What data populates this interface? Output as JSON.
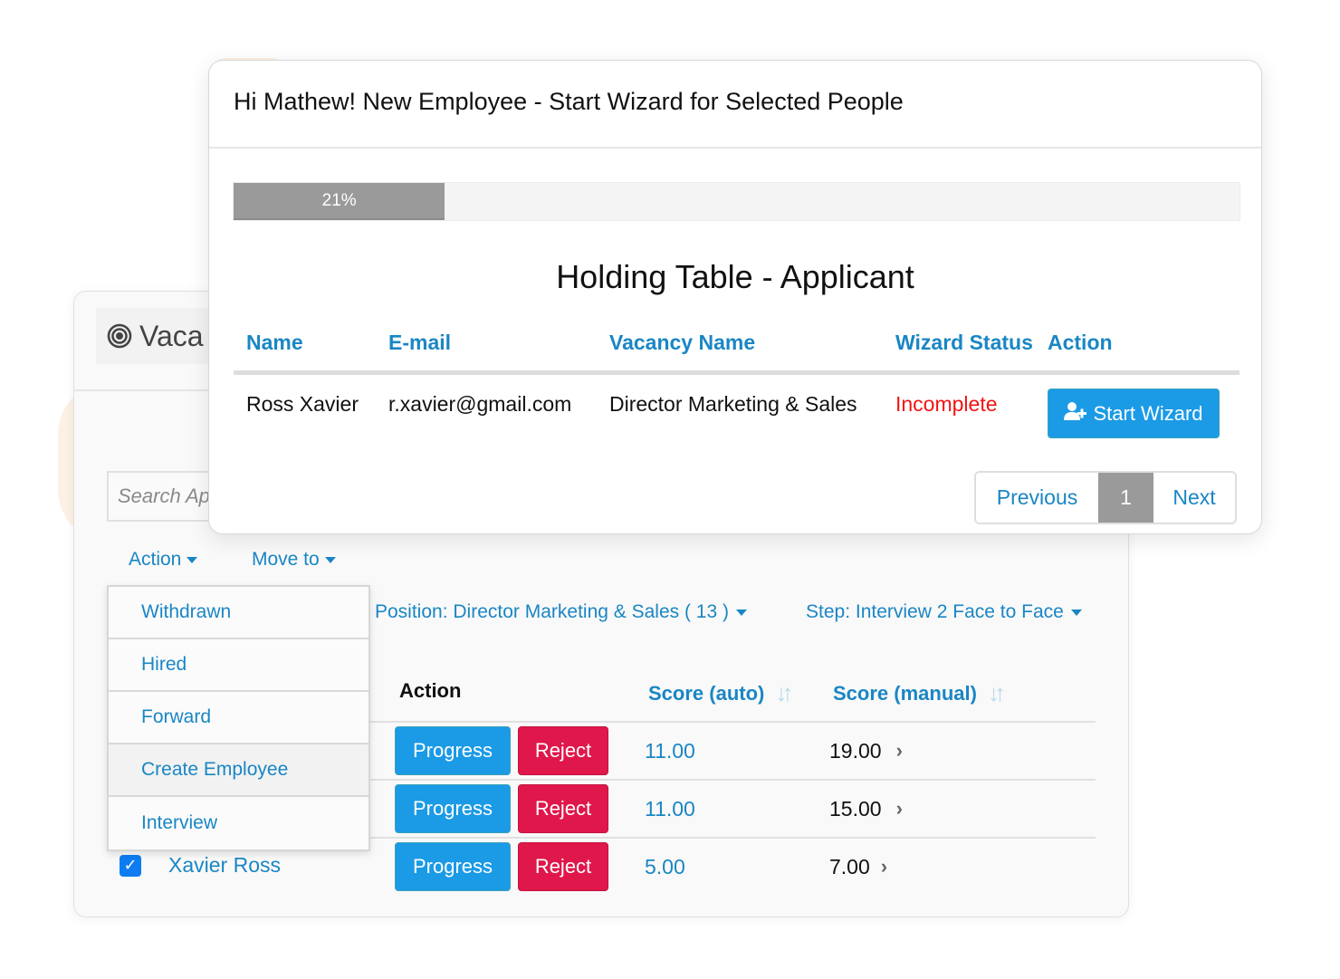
{
  "back_panel": {
    "title": "Vacancies",
    "title_visible": "Vaca",
    "title_icon": "target-icon",
    "search": {
      "placeholder": "Search Applicants",
      "placeholder_visible": "Search Ap",
      "value": ""
    },
    "toolbar": {
      "action_label": "Action",
      "move_to_label": "Move to"
    },
    "action_menu": {
      "items": [
        {
          "label": "Withdrawn"
        },
        {
          "label": "Hired"
        },
        {
          "label": "Forward"
        },
        {
          "label": "Create Employee",
          "highlighted": true
        },
        {
          "label": "Interview"
        }
      ]
    },
    "filters": {
      "position": "Position: Director Marketing & Sales ( 13 )",
      "step": "Step: Interview 2 Face to Face"
    },
    "table": {
      "columns": [
        "Action",
        "Score (auto)",
        "Score (manual)"
      ],
      "rows": [
        {
          "progress_label": "Progress",
          "reject_label": "Reject",
          "score_auto": "11.00",
          "score_manual": "19.00"
        },
        {
          "progress_label": "Progress",
          "reject_label": "Reject",
          "score_auto": "11.00",
          "score_manual": "15.00"
        },
        {
          "applicant": "Xavier Ross",
          "checked": true,
          "progress_label": "Progress",
          "reject_label": "Reject",
          "score_auto": "5.00",
          "score_manual": "7.00"
        }
      ]
    }
  },
  "modal": {
    "title": "Hi Mathew! New Employee - Start Wizard for Selected People",
    "progress": {
      "percent": 21,
      "label": "21%"
    },
    "table_title": "Holding Table - Applicant",
    "columns": [
      "Name",
      "E-mail",
      "Vacancy Name",
      "Wizard Status",
      "Action"
    ],
    "rows": [
      {
        "name": "Ross Xavier",
        "email": "r.xavier@gmail.com",
        "vacancy": "Director Marketing & Sales",
        "status": "Incomplete",
        "action_label": "Start Wizard"
      }
    ],
    "pagination": {
      "previous": "Previous",
      "current": "1",
      "next": "Next"
    }
  },
  "colors": {
    "link_blue": "#1a86c4",
    "primary_button": "#1b9ae6",
    "danger_button": "#e0174b",
    "status_incomplete": "#f01414",
    "progress_fill": "#9a9a9a"
  }
}
